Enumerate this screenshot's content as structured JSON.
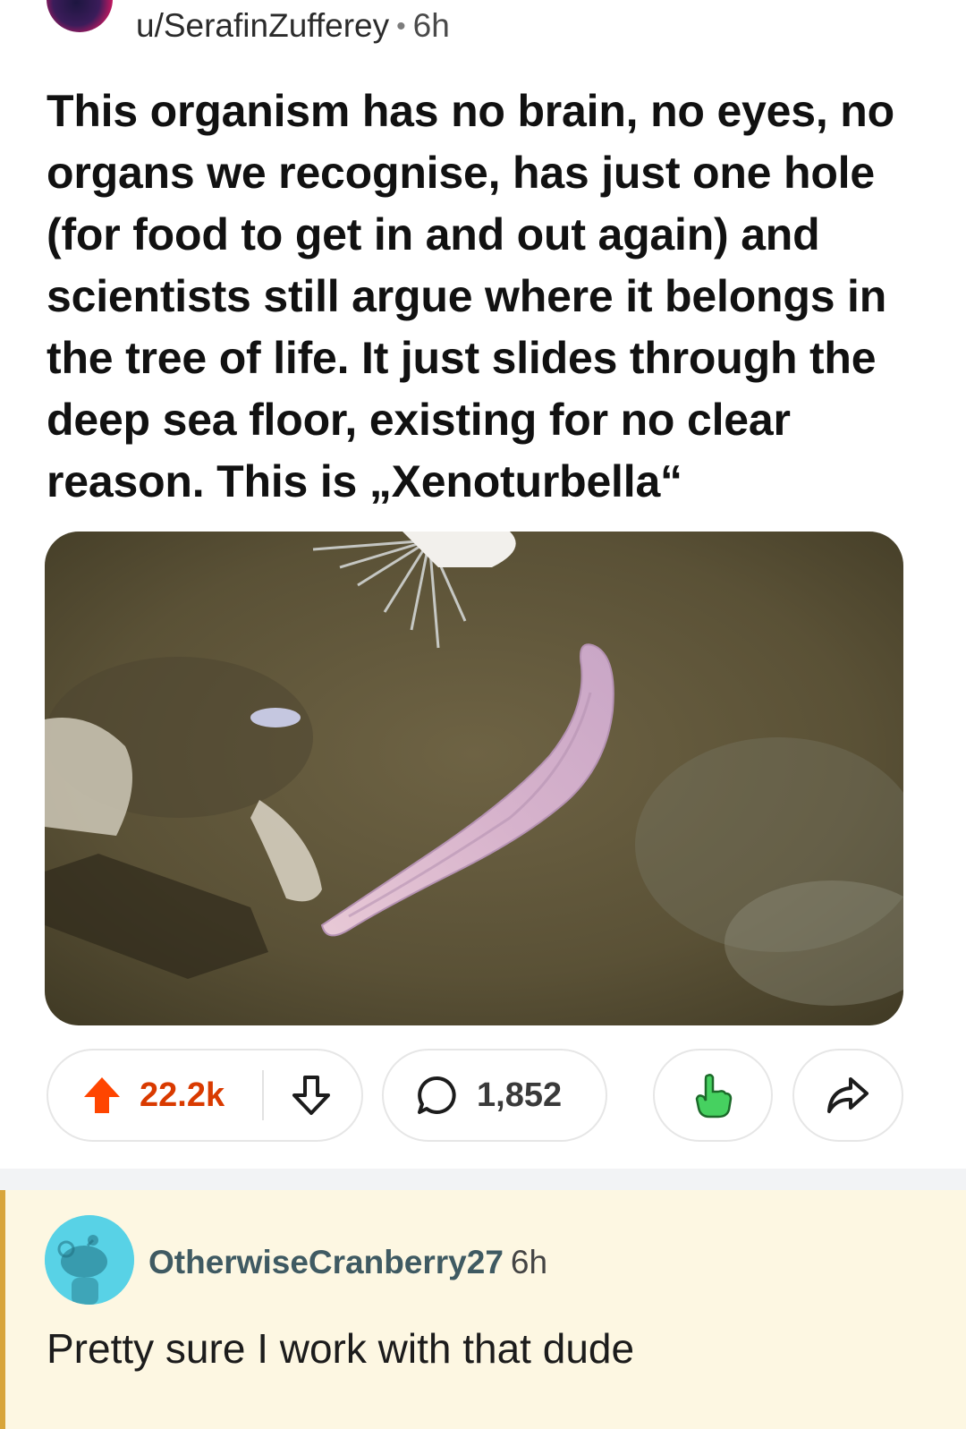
{
  "post": {
    "author": "u/SerafinZufferey",
    "separator": "•",
    "age": "6h",
    "title": "This organism has no brain, no eyes, no organs we recognise, has just one hole (for food to get in and out again) and scientists still argue where it belongs in the tree of life. It just slides through the deep sea floor, existing for no clear reason. This is „Xenoturbella“"
  },
  "actions": {
    "score": "22.2k",
    "comments": "1,852"
  },
  "comment": {
    "author": "OtherwiseCranberry27",
    "age": "6h",
    "body": "Pretty sure I work with that dude"
  },
  "colors": {
    "upvote": "#ff4500",
    "score": "#d93a00",
    "comment_highlight": "#fdf7e2",
    "comment_border": "#d8a53b",
    "award_green": "#46d160"
  },
  "icons": [
    "upvote-arrow-icon",
    "downvote-arrow-icon",
    "comment-bubble-icon",
    "award-hand-icon",
    "share-arrow-icon",
    "snoo-avatar-icon"
  ]
}
